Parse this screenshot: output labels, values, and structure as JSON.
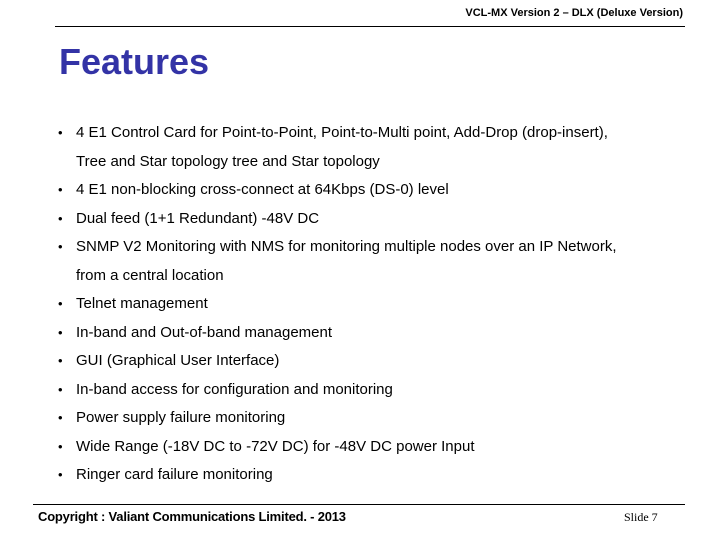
{
  "header": {
    "text": "VCL-MX Version 2 – DLX (Deluxe Version)"
  },
  "title": "Features",
  "colors": {
    "title": "#3333a6",
    "text": "#000000",
    "background": "#ffffff"
  },
  "bullet_glyph": "•",
  "bullets": [
    {
      "line1": "4 E1 Control Card for Point-to-Point, Point-to-Multi point, Add-Drop (drop-insert),",
      "line2": "Tree and Star topology tree and Star topology"
    },
    {
      "line1": "4 E1 non-blocking cross-connect at 64Kbps (DS-0) level"
    },
    {
      "line1": "Dual feed (1+1 Redundant) -48V DC"
    },
    {
      "line1": "SNMP V2 Monitoring with NMS for monitoring multiple nodes over an IP Network,",
      "line2": "from a central location"
    },
    {
      "line1": "Telnet management"
    },
    {
      "line1": "In-band and Out-of-band management"
    },
    {
      "line1": "GUI (Graphical User Interface)"
    },
    {
      "line1": "In-band access for configuration and monitoring"
    },
    {
      "line1": "Power supply failure monitoring"
    },
    {
      "line1": "Wide Range (-18V DC to -72V DC) for -48V DC power Input"
    },
    {
      "line1": "Ringer card failure monitoring"
    }
  ],
  "footer": {
    "copyright": "Copyright : Valiant Communications Limited. - 2013",
    "slide": "Slide 7"
  }
}
